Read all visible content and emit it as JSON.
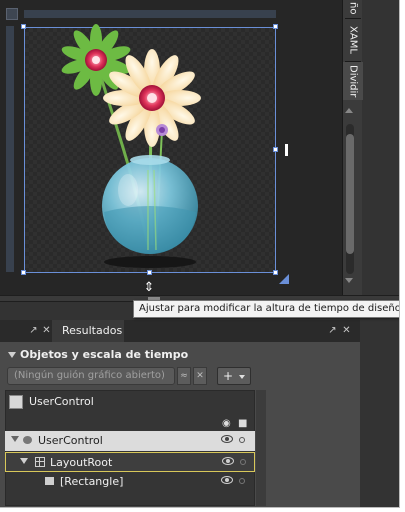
{
  "design_surface": {
    "vtabs": [
      "ño",
      "XAML",
      "Dividir"
    ]
  },
  "tooltip": "Ajustar para modificar la altura de tiempo de diseño",
  "results_panel": {
    "tab_label": "Resultados",
    "header": "Objetos y escala de tiempo",
    "storyboard_placeholder": "(Ningún guión gráfico abierto)",
    "add_label": "+",
    "scope_label": "UserControl",
    "tree": [
      {
        "label": "UserControl"
      },
      {
        "label": "LayoutRoot"
      },
      {
        "label": "[Rectangle]"
      }
    ]
  },
  "icons": [
    "resize-cursor-icon",
    "pin-icon",
    "close-icon",
    "eye-icon",
    "lock-icon",
    "lock-dot-icon",
    "grid-icon",
    "rectangle-icon",
    "usercontrol-icon",
    "collapse-icon"
  ]
}
